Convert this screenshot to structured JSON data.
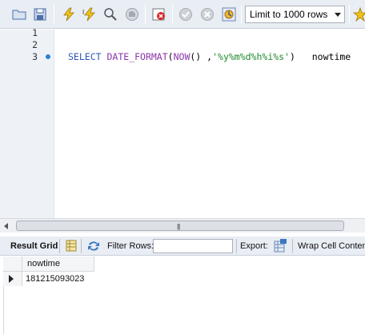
{
  "toolbar": {
    "buttons": [
      {
        "icon": "open-folder-icon"
      },
      {
        "icon": "save-icon"
      },
      {
        "icon": "execute-icon"
      },
      {
        "icon": "execute-current-icon"
      },
      {
        "icon": "explain-icon"
      },
      {
        "icon": "stop-icon"
      },
      {
        "icon": "toggle-error-icon"
      },
      {
        "icon": "commit-icon"
      },
      {
        "icon": "rollback-icon"
      },
      {
        "icon": "autocommit-icon"
      },
      {
        "icon": "beautify-icon"
      }
    ],
    "limit_value": "Limit to 1000 rows"
  },
  "editor": {
    "line_numbers": [
      "1",
      "2",
      "3"
    ],
    "query": {
      "kw_select": "SELECT",
      "fn_name": "DATE_FORMAT",
      "paren_open": "(",
      "fn_now": "NOW",
      "paren_now": "()",
      "comma": " ,",
      "format_str": "'%y%m%d%h%i%s'",
      "paren_close": ")",
      "alias": "nowtime"
    }
  },
  "results": {
    "result_grid_label": "Result Grid",
    "filter_label": "Filter Rows:",
    "filter_value": "",
    "export_label": "Export:",
    "wrap_label": "Wrap Cell Content",
    "columns": [
      "nowtime"
    ],
    "rows": [
      [
        "181215093023"
      ]
    ]
  },
  "colors": {
    "keyword": "#2a59b4",
    "function": "#8a36a8",
    "string": "#1e8a2e",
    "execution_dot": "#2b7fd8"
  }
}
